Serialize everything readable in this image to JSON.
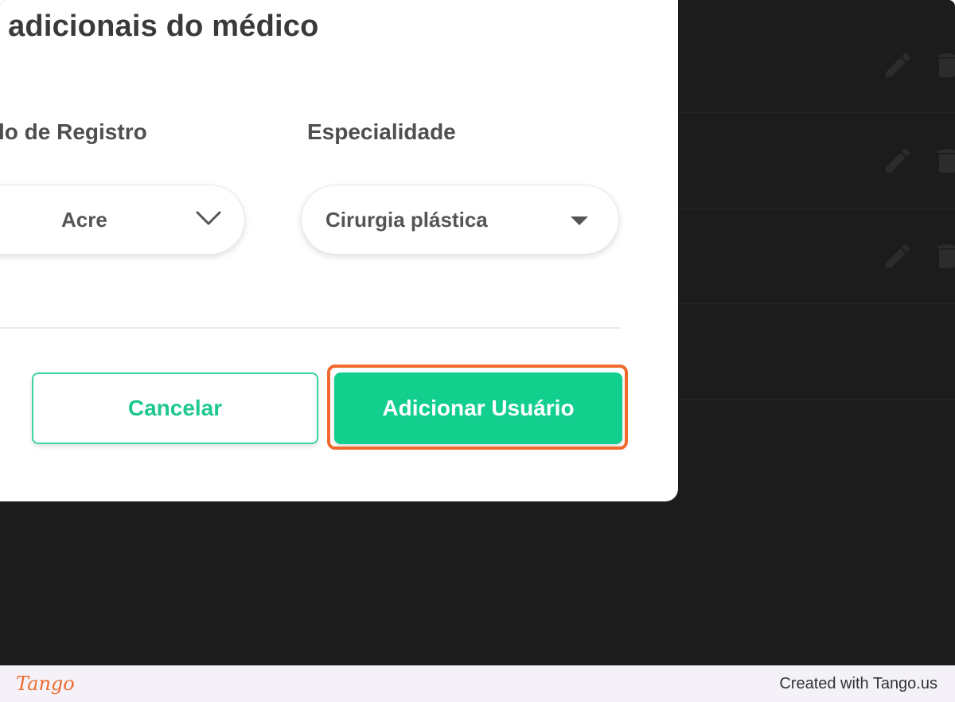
{
  "modal": {
    "title": "s adicionais do médico",
    "fields": {
      "registro": {
        "label": "lo de Registro",
        "value": "Acre"
      },
      "especialidade": {
        "label": "Especialidade",
        "value": "Cirurgia plástica"
      }
    },
    "buttons": {
      "cancel_label": "Cancelar",
      "add_label": "Adicionar Usuário"
    }
  },
  "background_rows": [
    {
      "actions": [
        "edit-icon",
        "delete-icon"
      ]
    },
    {
      "actions": [
        "edit-icon",
        "delete-icon"
      ]
    },
    {
      "actions": [
        "edit-icon",
        "delete-icon"
      ]
    }
  ],
  "footer": {
    "logo": "Tango",
    "credit": "Created with Tango.us"
  },
  "colors": {
    "accent": "#12cf8e",
    "highlight": "#f06a2e",
    "overlay": "#1c1c1c"
  }
}
